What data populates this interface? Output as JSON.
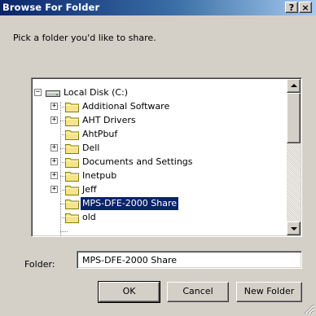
{
  "window": {
    "title": "Browse For Folder",
    "help_label": "?",
    "close_label": "×"
  },
  "prompt": "Pick a folder you'd like to share.",
  "tree": {
    "root": {
      "label": "Local Disk (C:)",
      "icon": "drive-icon",
      "expanded": true
    },
    "items": [
      {
        "label": "Additional Software",
        "has_children": true,
        "selected": false
      },
      {
        "label": "AHT Drivers",
        "has_children": true,
        "selected": false
      },
      {
        "label": "AhtPbuf",
        "has_children": false,
        "selected": false
      },
      {
        "label": "Dell",
        "has_children": true,
        "selected": false
      },
      {
        "label": "Documents and Settings",
        "has_children": true,
        "selected": false
      },
      {
        "label": "Inetpub",
        "has_children": true,
        "selected": false
      },
      {
        "label": "Jeff",
        "has_children": true,
        "selected": false
      },
      {
        "label": "MPS-DFE-2000 Share",
        "has_children": false,
        "selected": true
      },
      {
        "label": "old",
        "has_children": false,
        "selected": false
      }
    ]
  },
  "folder_field": {
    "label": "Folder:",
    "value": "MPS-DFE-2000 Share"
  },
  "buttons": {
    "ok": "OK",
    "cancel": "Cancel",
    "new_folder": "New Folder"
  },
  "colors": {
    "title_gradient_start": "#0a246a",
    "title_gradient_end": "#a6caf0",
    "selection": "#0a246a",
    "face": "#d4d0c8",
    "folder": "#f7e48a"
  }
}
